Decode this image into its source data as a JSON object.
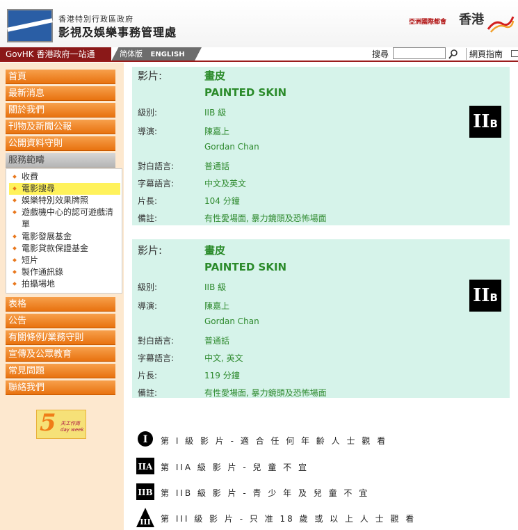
{
  "header": {
    "dept_small": "香港特別行政區政府",
    "dept_big": "影視及娛樂事務管理處",
    "asia_city": "亞洲國際都會",
    "hong_kong": "香港"
  },
  "nav": {
    "govhk": "GovHK 香港政府一站通",
    "simplified": "简体版",
    "english": "ENGLISH",
    "search_label": "搜尋",
    "search_value": "",
    "sitemap": "網頁指南"
  },
  "sidebar": {
    "items_top": [
      "首頁",
      "最新消息",
      "關於我們",
      "刊物及新聞公報",
      "公開資料守則",
      "服務範疇"
    ],
    "sub_items": [
      "收費",
      "電影搜尋",
      "娛樂特別效果牌照",
      "遊戲機中心的認可遊戲清單",
      "電影發展基金",
      "電影貸款保證基金",
      "短片",
      "製作通訊錄",
      "拍攝場地"
    ],
    "items_bottom": [
      "表格",
      "公告",
      "有關條例/業務守則",
      "宣傳及公眾教育",
      "常見問題",
      "聯絡我們"
    ],
    "badge_num": "5",
    "badge_text": "天工作周 day week"
  },
  "labels": {
    "film": "影片:",
    "rating": "級別:",
    "director": "導演:",
    "dialogue": "對白語言:",
    "subtitle": "字幕語言:",
    "length": "片長:",
    "remarks": "備註:"
  },
  "films": [
    {
      "title_zh": "畫皮",
      "title_en": "PAINTED SKIN",
      "rating": "IIB 級",
      "director_zh": "陳嘉上",
      "director_en": "Gordan Chan",
      "dialogue": "普通話",
      "subtitle": "中文及英文",
      "length": "104 分鐘",
      "remarks": "有性愛場面, 暴力鏡頭及恐怖場面",
      "badge_main": "II",
      "badge_sub": "B"
    },
    {
      "title_zh": "畫皮",
      "title_en": "PAINTED SKIN",
      "rating": "IIB 級",
      "director_zh": "陳嘉上",
      "director_en": "Gordan Chan",
      "dialogue": "普通話",
      "subtitle": "中文, 英文",
      "length": "119 分鐘",
      "remarks": "有性愛場面, 暴力鏡頭及恐怖場面",
      "badge_main": "II",
      "badge_sub": "B"
    }
  ],
  "legend": [
    {
      "icon": "I",
      "text": "第 I 級 影 片 - 適 合 任 何 年 齡 人 士 觀 看"
    },
    {
      "icon": "IIA",
      "text": "第 IIA 級 影 片 - 兒 童 不 宜"
    },
    {
      "icon": "IIB",
      "text": "第 IIB 級 影 片 - 青 少 年 及 兒 童 不 宜"
    },
    {
      "icon": "III",
      "text": "第 III 級 影 片 - 只 准 18 歲 或 以 上 人 士 觀 看"
    }
  ]
}
